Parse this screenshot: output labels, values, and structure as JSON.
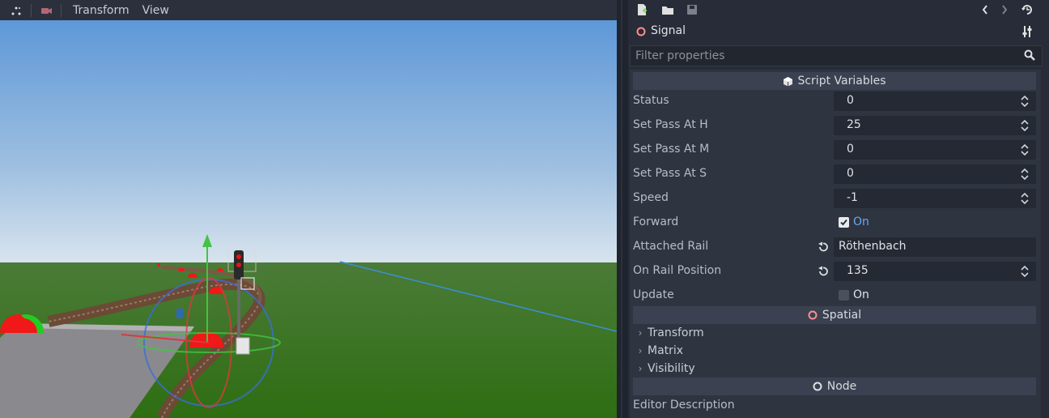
{
  "viewport": {
    "toolbar": {
      "menus": [
        "Transform",
        "View"
      ]
    }
  },
  "inspector": {
    "toolbar": {
      "icons": [
        "new-resource-icon",
        "open-folder-icon",
        "save-icon",
        "history-back-icon",
        "history-forward-icon",
        "history-list-icon"
      ]
    },
    "node_name": "Signal",
    "filter_placeholder": "Filter properties",
    "sections": {
      "script_variables": "Script Variables",
      "spatial": "Spatial",
      "node": "Node"
    },
    "properties": [
      {
        "label": "Status",
        "value": "0"
      },
      {
        "label": "Set Pass At H",
        "value": "25"
      },
      {
        "label": "Set Pass At M",
        "value": "0"
      },
      {
        "label": "Set Pass At S",
        "value": "0"
      },
      {
        "label": "Speed",
        "value": "-1"
      },
      {
        "label": "Forward",
        "value": "On"
      },
      {
        "label": "Attached Rail",
        "value": "Röthenbach"
      },
      {
        "label": "On Rail Position",
        "value": "135"
      },
      {
        "label": "Update",
        "value": "On"
      }
    ],
    "spatial_groups": [
      "Transform",
      "Matrix",
      "Visibility"
    ],
    "node_props": [
      "Editor Description"
    ],
    "colors": {
      "accent": "#6aa9f0",
      "signal_icon": "#fc8f8f",
      "panel": "#2f3441"
    }
  }
}
